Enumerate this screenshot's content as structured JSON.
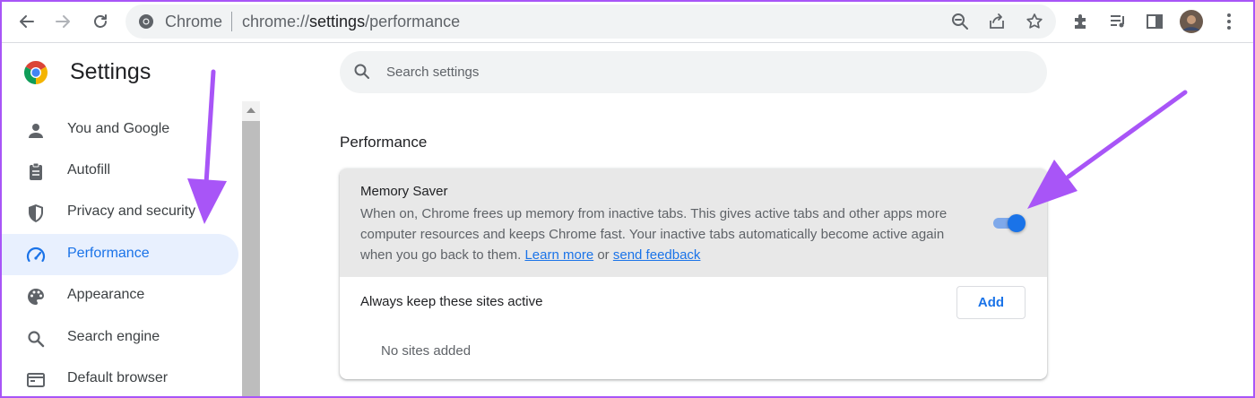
{
  "toolbar": {
    "back_icon": "arrow-back-icon",
    "forward_icon": "arrow-forward-icon",
    "reload_icon": "reload-icon",
    "omnibox": {
      "site_name": "Chrome",
      "url_scheme": "chrome://",
      "url_host": "settings",
      "url_path": "/performance"
    },
    "omnibox_icons": [
      "zoom-out-icon",
      "share-icon",
      "bookmark-star-icon"
    ],
    "right_icons": [
      "extensions-icon",
      "media-queue-icon",
      "side-panel-icon",
      "profile-avatar",
      "kebab-menu-icon"
    ]
  },
  "sidebar": {
    "title": "Settings",
    "items": [
      {
        "label": "You and Google",
        "icon": "person-icon",
        "active": false
      },
      {
        "label": "Autofill",
        "icon": "clipboard-icon",
        "active": false
      },
      {
        "label": "Privacy and security",
        "icon": "shield-icon",
        "active": false
      },
      {
        "label": "Performance",
        "icon": "speedometer-icon",
        "active": true
      },
      {
        "label": "Appearance",
        "icon": "palette-icon",
        "active": false
      },
      {
        "label": "Search engine",
        "icon": "search-icon",
        "active": false
      },
      {
        "label": "Default browser",
        "icon": "browser-window-icon",
        "active": false
      }
    ]
  },
  "main": {
    "search_placeholder": "Search settings",
    "section_title": "Performance",
    "memory_saver": {
      "title": "Memory Saver",
      "description": "When on, Chrome frees up memory from inactive tabs. This gives active tabs and other apps more computer resources and keeps Chrome fast. Your inactive tabs automatically become active again when you go back to them.",
      "learn_more": "Learn more",
      "or_text": "or",
      "send_feedback": "send feedback",
      "enabled": true
    },
    "always_active": {
      "label": "Always keep these sites active",
      "add_button": "Add",
      "empty_text": "No sites added"
    }
  },
  "colors": {
    "accent": "#1a73e8",
    "active_nav_bg": "#e8f0fe",
    "annotation_arrow": "#a855f7"
  }
}
